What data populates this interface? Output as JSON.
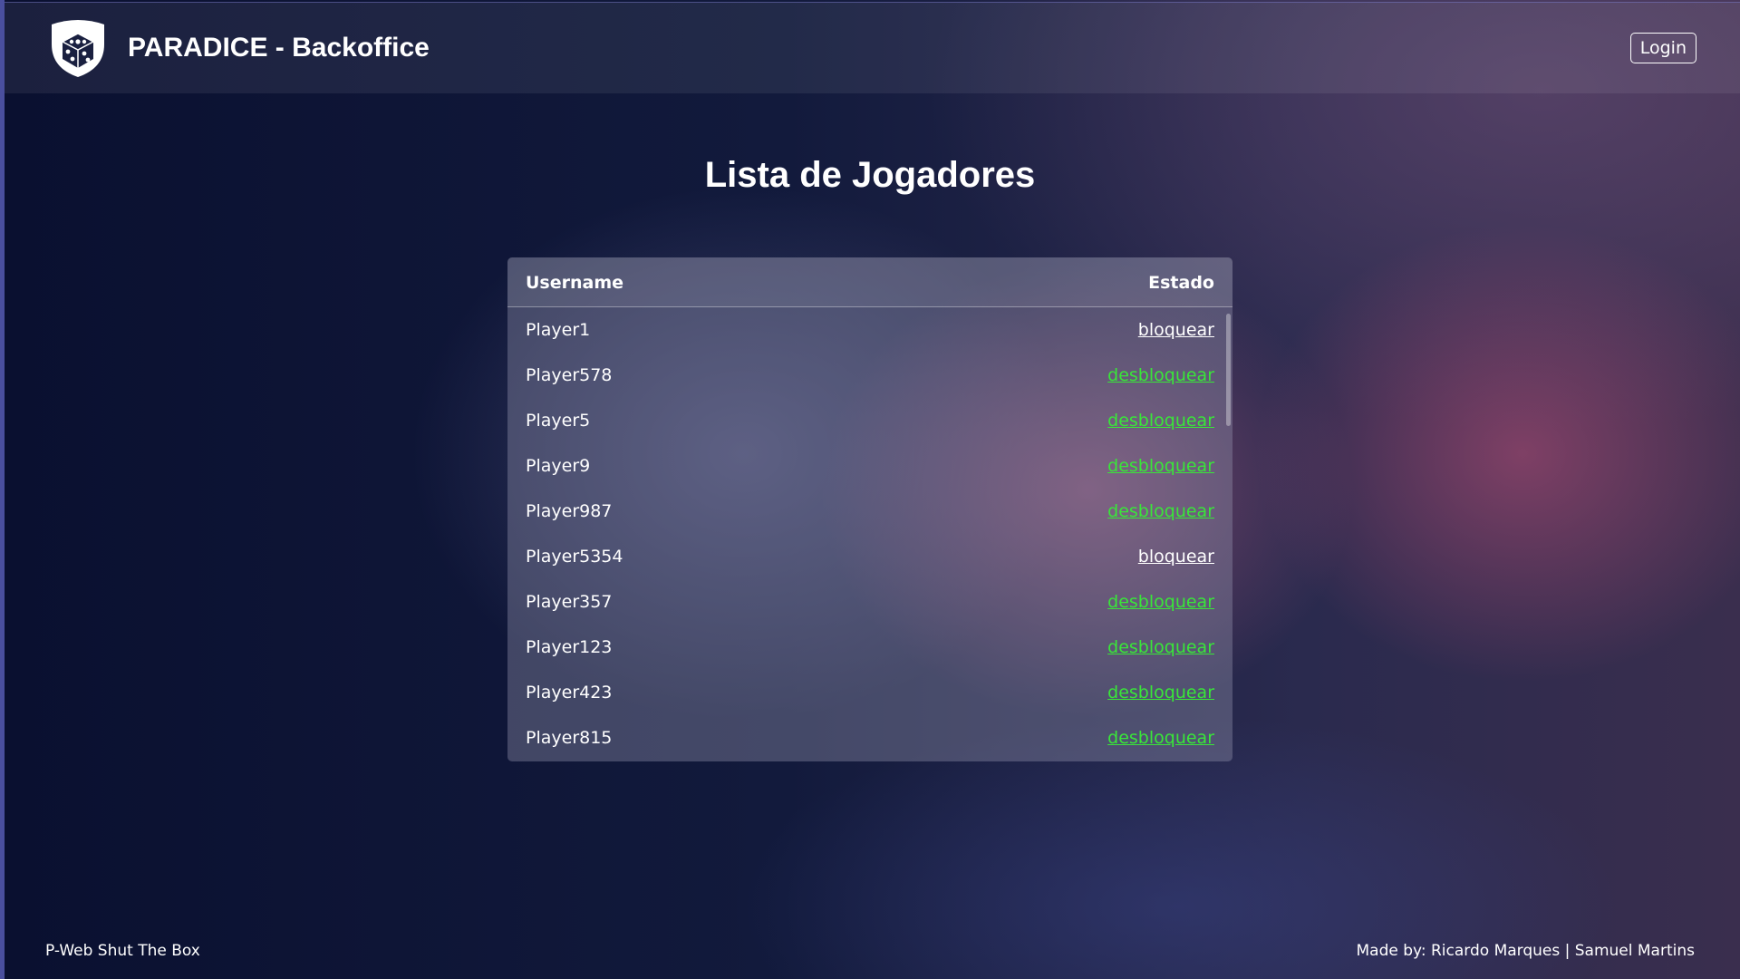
{
  "header": {
    "brand_title": "PARADICE - Backoffice",
    "login_label": "Login",
    "logo_icon": "shield-dice-icon"
  },
  "main": {
    "page_title": "Lista de Jogadores",
    "table": {
      "columns": [
        "Username",
        "Estado"
      ],
      "rows": [
        {
          "username": "Player1",
          "action": "bloquear",
          "status": "block"
        },
        {
          "username": "Player578",
          "action": "desbloquear",
          "status": "unblock"
        },
        {
          "username": "Player5",
          "action": "desbloquear",
          "status": "unblock"
        },
        {
          "username": "Player9",
          "action": "desbloquear",
          "status": "unblock"
        },
        {
          "username": "Player987",
          "action": "desbloquear",
          "status": "unblock"
        },
        {
          "username": "Player5354",
          "action": "bloquear",
          "status": "block"
        },
        {
          "username": "Player357",
          "action": "desbloquear",
          "status": "unblock"
        },
        {
          "username": "Player123",
          "action": "desbloquear",
          "status": "unblock"
        },
        {
          "username": "Player423",
          "action": "desbloquear",
          "status": "unblock"
        },
        {
          "username": "Player815",
          "action": "desbloquear",
          "status": "unblock"
        }
      ]
    }
  },
  "footer": {
    "left_text": "P-Web Shut The Box",
    "right_text": "Made by: Ricardo Marques | Samuel Martins"
  },
  "colors": {
    "unblock_link": "#39e639",
    "block_link": "#ffffff",
    "background_dark": "#0d1430",
    "accent_glow": "#be5078"
  }
}
